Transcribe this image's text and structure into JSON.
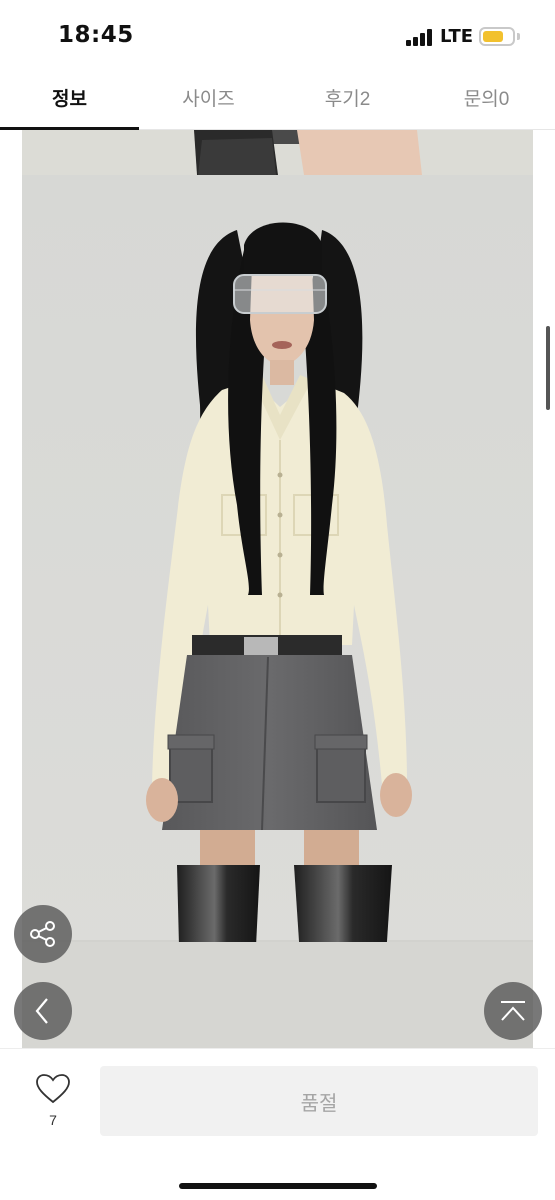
{
  "status": {
    "time": "18:45",
    "network": "LTE",
    "icons": [
      "signal-icon",
      "battery-icon"
    ]
  },
  "tabs": [
    {
      "label": "정보",
      "active": true
    },
    {
      "label": "사이즈",
      "active": false
    },
    {
      "label": "후기2",
      "active": false
    },
    {
      "label": "문의0",
      "active": false
    }
  ],
  "floating_buttons": [
    "share-icon",
    "back-icon",
    "scroll-top-icon"
  ],
  "bottom": {
    "like_icon": "heart-icon",
    "like_count": "7",
    "action_label": "품절"
  },
  "colors": {
    "accent": "#111111",
    "button_bg": "#f1f1f1",
    "button_text": "#a5a5a5",
    "battery": "#f2c12e"
  }
}
